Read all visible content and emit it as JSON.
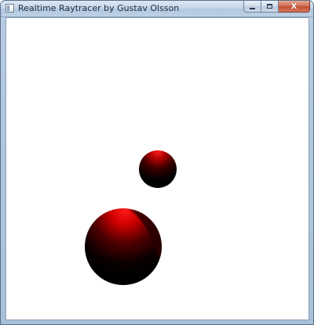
{
  "window": {
    "title": "Realtime Raytracer by Gustav Olsson",
    "icon": "app-window-icon",
    "controls": {
      "minimize_icon": "minimize-icon",
      "maximize_icon": "maximize-icon",
      "close_label": "X",
      "close_icon": "close-icon"
    }
  },
  "scene": {
    "background_color": "#ffffff",
    "spheres": [
      {
        "name": "small-sphere",
        "color_highlight": "#ff1a1a",
        "color_shadow": "#000000"
      },
      {
        "name": "large-sphere",
        "color_highlight": "#ff1a1a",
        "color_shadow": "#000000"
      }
    ]
  }
}
